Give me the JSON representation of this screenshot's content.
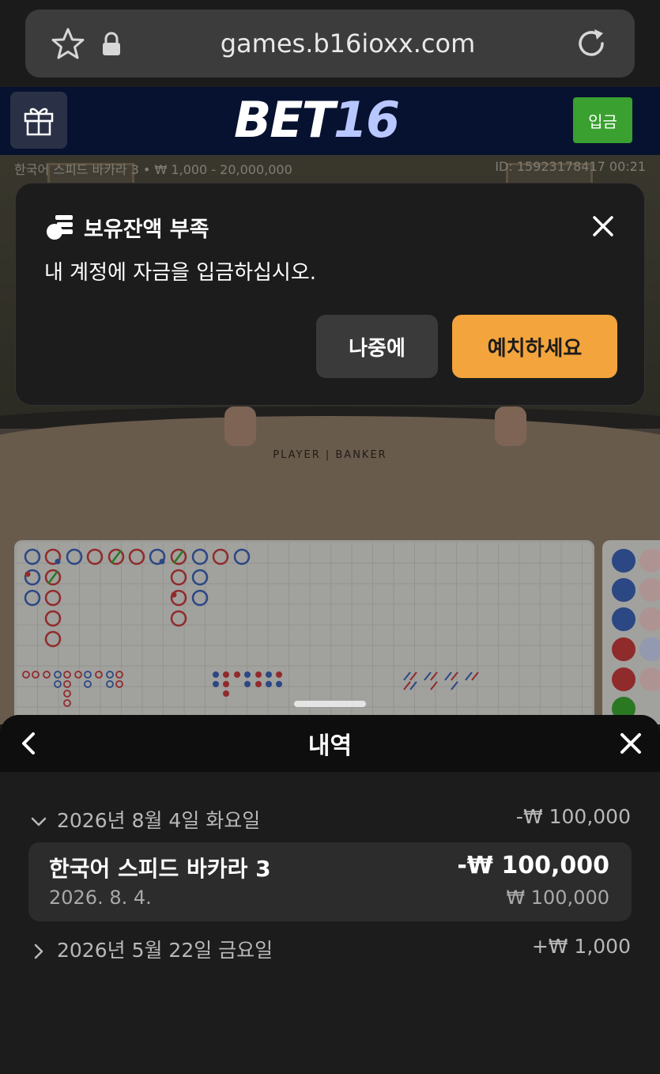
{
  "browser": {
    "url": "games.b16ioxx.com"
  },
  "header": {
    "brand_main": "BET",
    "brand_num": "16",
    "deposit_label": "입금"
  },
  "game": {
    "info": "한국어 스피드 바카라 3 • ₩ 1,000 - 20,000,000",
    "id_time": "ID: 15923178417 00:21",
    "table_label": "PLAYER | BANKER"
  },
  "dialog": {
    "title": "보유잔액 부족",
    "message": "내 계정에 자금을 입금하십시오.",
    "later_label": "나중에",
    "deposit_label": "예치하세요"
  },
  "history": {
    "title": "내역",
    "groups": [
      {
        "date": "2026년 8월 4일 화요일",
        "amount": "-₩ 100,000",
        "expanded": true
      },
      {
        "date": "2026년 5월 22일 금요일",
        "amount": "+₩ 1,000",
        "expanded": false
      }
    ],
    "entry": {
      "game_name": "한국어 스피드 바카라 3",
      "date": "2026. 8. 4.",
      "net": "-₩ 100,000",
      "stake": "₩ 100,000"
    }
  },
  "colors": {
    "deposit_green": "#3aa02f",
    "accent_orange": "#f3a43c",
    "header_navy": "#071230",
    "player_blue": "#3a5fb0",
    "banker_red": "#c03a3a"
  }
}
